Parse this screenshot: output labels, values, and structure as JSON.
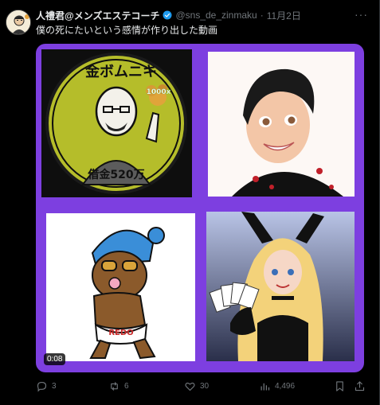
{
  "tweet": {
    "author_name": "人禮君@メンズエステコーチ",
    "handle": "@sns_de_zinmaku",
    "separator": "·",
    "date": "11月2日",
    "text": "僕の死にたいという感情が作り出した動画",
    "more_label": "···"
  },
  "media": {
    "tile1": {
      "title_text": "金ボムニキ",
      "badge_text": "1000x",
      "caption_text": "借金520万"
    },
    "tile3": {
      "shorts_text": "REDO"
    },
    "video_duration": "0:08"
  },
  "actions": {
    "replies": "3",
    "reposts": "6",
    "likes": "30",
    "views": "4,496"
  },
  "colors": {
    "background": "#000000",
    "text": "#e7e9ea",
    "muted": "#71767b",
    "media_frame": "#7d3fe0",
    "verified": "#1d9bf0"
  },
  "icons": [
    "verified-badge-icon",
    "more-icon",
    "reply-icon",
    "repost-icon",
    "like-icon",
    "views-icon",
    "bookmark-icon",
    "share-icon"
  ]
}
